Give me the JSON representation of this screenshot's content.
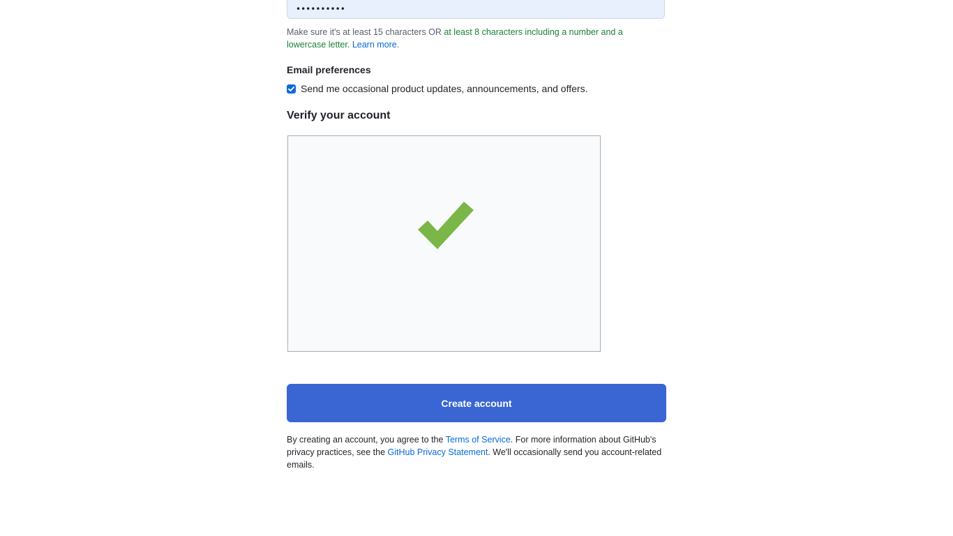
{
  "password": {
    "value_mask": "••••••••••"
  },
  "hint": {
    "part1": "Make sure it's at least 15 characters OR ",
    "ok_text": "at least 8 characters including a number and a lowercase letter.",
    "link": "Learn more",
    "end": "."
  },
  "email_preferences": {
    "title": "Email preferences",
    "checkbox_label": "Send me occasional product updates, announcements, and offers.",
    "checked": true
  },
  "verify": {
    "title": "Verify your account"
  },
  "create_button": {
    "label": "Create account"
  },
  "legal": {
    "part1": "By creating an account, you agree to the ",
    "terms_link": "Terms of Service",
    "part2": ". For more information about GitHub's privacy practices, see the ",
    "privacy_link": "GitHub Privacy Statement",
    "part3": ". We'll occasionally send you account-related emails."
  },
  "colors": {
    "primary_button": "#3966d3",
    "checkmark": "#7ab648",
    "link": "#0969da",
    "hint_ok": "#1a7f37"
  },
  "icons": {
    "captcha_success": "checkmark-icon",
    "checkbox": "checkbox-checked-icon"
  }
}
